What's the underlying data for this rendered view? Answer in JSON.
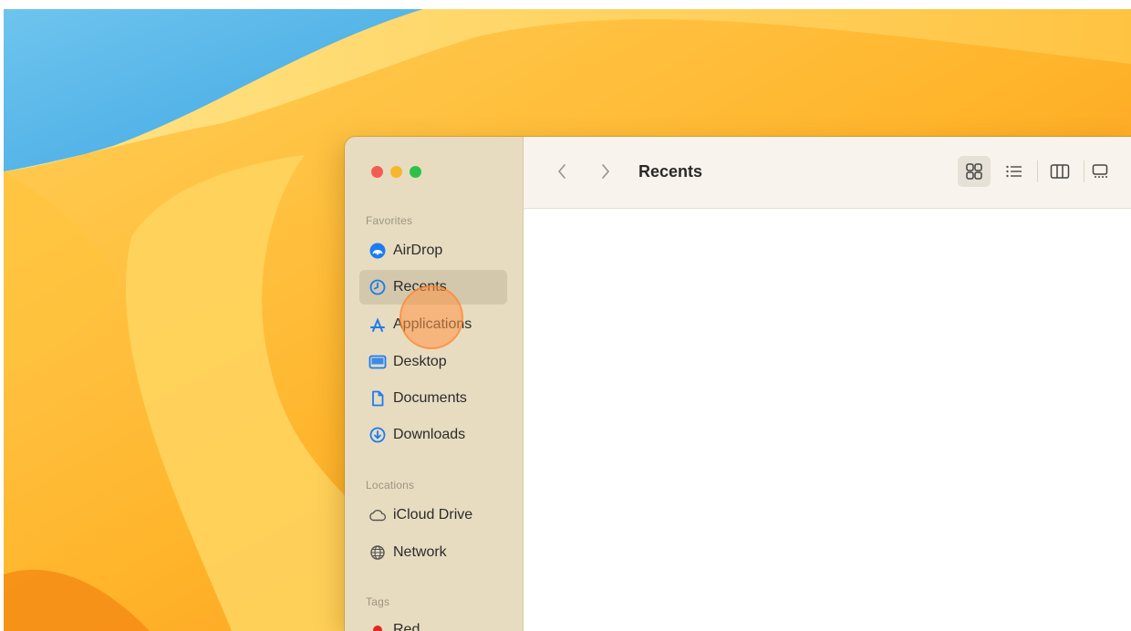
{
  "finder": {
    "toolbar": {
      "title": "Recents",
      "back_icon": "chevron-left-icon",
      "forward_icon": "chevron-right-icon",
      "views": [
        "icon-view-icon",
        "list-view-icon",
        "column-view-icon",
        "gallery-view-icon"
      ],
      "active_view": "icon-view-icon"
    },
    "sidebar": {
      "favorites_label": "Favorites",
      "favorites": [
        {
          "label": "AirDrop",
          "icon": "airdrop-icon"
        },
        {
          "label": "Recents",
          "icon": "clock-icon",
          "selected": true
        },
        {
          "label": "Applications",
          "icon": "applications-icon"
        },
        {
          "label": "Desktop",
          "icon": "desktop-icon"
        },
        {
          "label": "Documents",
          "icon": "document-icon"
        },
        {
          "label": "Downloads",
          "icon": "download-icon"
        }
      ],
      "locations_label": "Locations",
      "locations": [
        {
          "label": "iCloud Drive",
          "icon": "cloud-icon"
        },
        {
          "label": "Network",
          "icon": "network-icon"
        }
      ],
      "tags_label": "Tags",
      "tags": [
        {
          "label": "Red",
          "color": "#e0281e"
        }
      ]
    }
  },
  "colors": {
    "accent": "#1b7cf2",
    "sidebar_bg": "#e8dcc0",
    "toolbar_bg": "#f8f3ec",
    "wallpaper_blue": "#4ab2e8",
    "wallpaper_orange": "#f7a01c"
  }
}
